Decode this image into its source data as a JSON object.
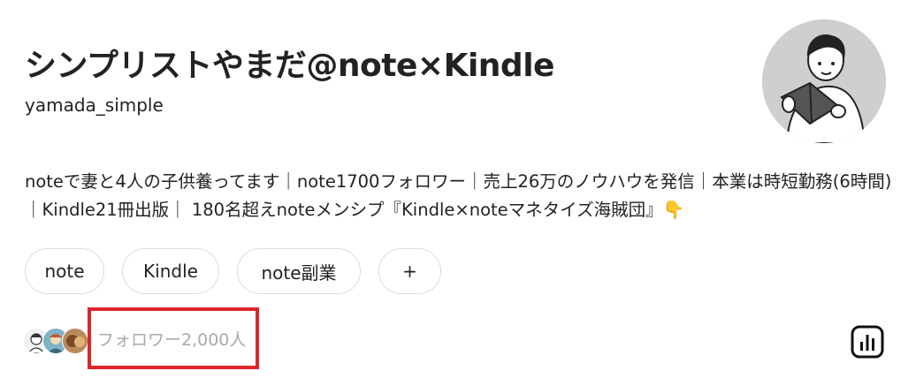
{
  "profile": {
    "display_name": "シンプリストやまだ@note×Kindle",
    "handle": "yamada_simple",
    "bio": "noteで妻と4人の子供養ってます｜note1700フォロワー｜売上26万のノウハウを発信｜本業は時短勤務(6時間)｜Kindle21冊出版｜ 180名超えnoteメンシプ『Kindle×noteマネタイズ海賊団』👇"
  },
  "tags": [
    {
      "label": "note"
    },
    {
      "label": "Kindle"
    },
    {
      "label": "note副業"
    },
    {
      "label": "+"
    }
  ],
  "followers": {
    "label": "フォロワー2,000人"
  },
  "colors": {
    "highlight_border": "#e0242a",
    "muted_text": "#aaaaaa"
  },
  "icons": {
    "stats": "bar-chart-icon",
    "avatar": "person-reading-book-illustration"
  }
}
